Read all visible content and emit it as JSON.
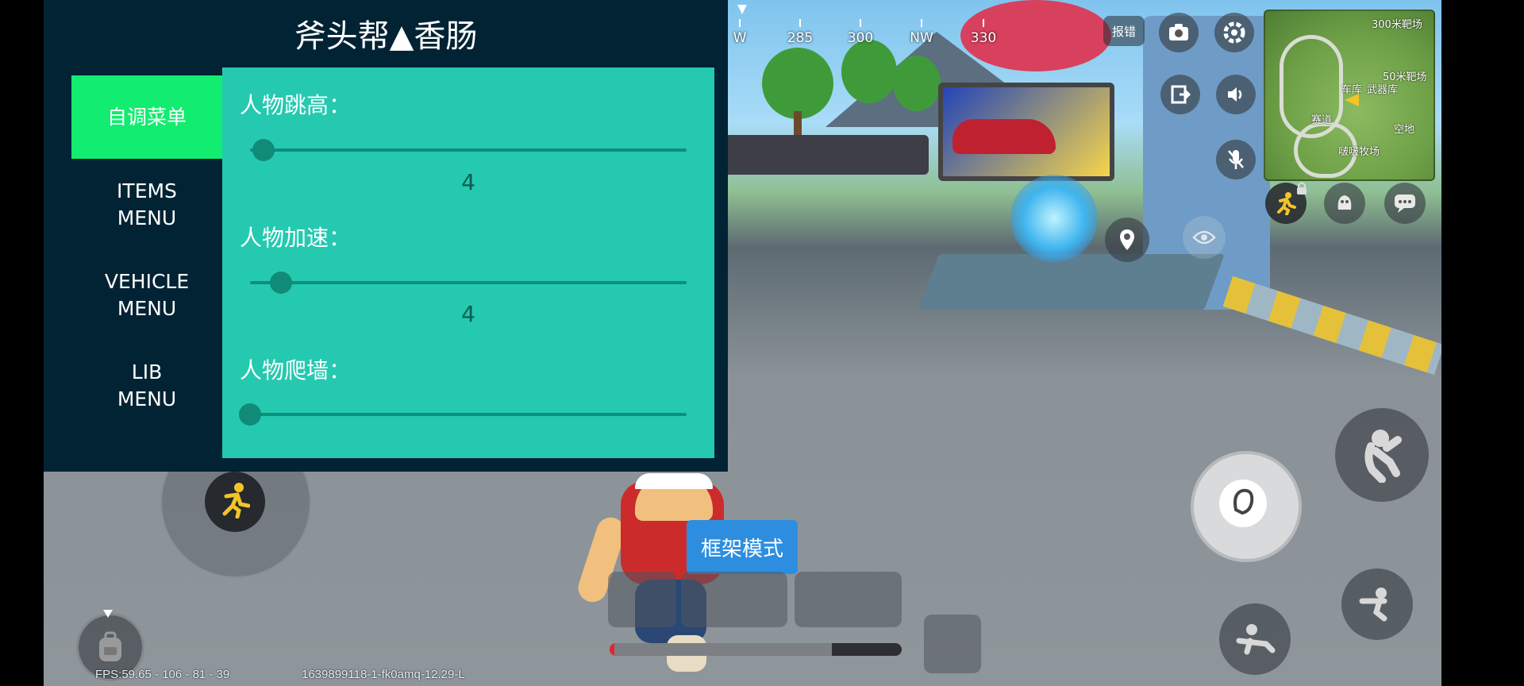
{
  "panel": {
    "title": "斧头帮▲香肠",
    "menu": [
      {
        "label": "自调菜单",
        "active": true
      },
      {
        "label": "ITEMS\nMENU",
        "active": false
      },
      {
        "label": "VEHICLE\nMENU",
        "active": false
      },
      {
        "label": "LIB\nMENU",
        "active": false
      }
    ],
    "sliders": [
      {
        "label": "人物跳高：",
        "value": "4",
        "fraction": 0.03
      },
      {
        "label": "人物加速：",
        "value": "4",
        "fraction": 0.07
      },
      {
        "label": "人物爬墙：",
        "value": "",
        "fraction": 0.0
      }
    ]
  },
  "hud": {
    "compass": [
      "W",
      "285",
      "300",
      "NW",
      "330"
    ],
    "report_label": "报错",
    "mode_button_label": "框架模式",
    "minimap_labels": [
      "300米靶场",
      "50米靶场",
      "车库",
      "武器库",
      "赛道",
      "空地",
      "啵啵牧场"
    ],
    "status_fps": "FPS:59.65 - 106 - 81 - 39",
    "status_build": "1639899118-1-fk0amq-12.29-L",
    "progress_fraction": 0.76
  },
  "colors": {
    "panel_bg": "#022334",
    "content_bg": "#24c9b0",
    "active_menu": "#12ec70",
    "slider": "#0f8b78",
    "mode_button": "#2d8ee0"
  },
  "icons": [
    "camera-icon",
    "gear-icon",
    "exit-icon",
    "speaker-icon",
    "mic-icon",
    "location-pin-icon",
    "eye-icon",
    "run-icon",
    "lock-icon",
    "emote-icon",
    "chat-icon",
    "jump-icon",
    "crouch-icon",
    "prone-icon",
    "backpack-icon",
    "punch-icon"
  ]
}
